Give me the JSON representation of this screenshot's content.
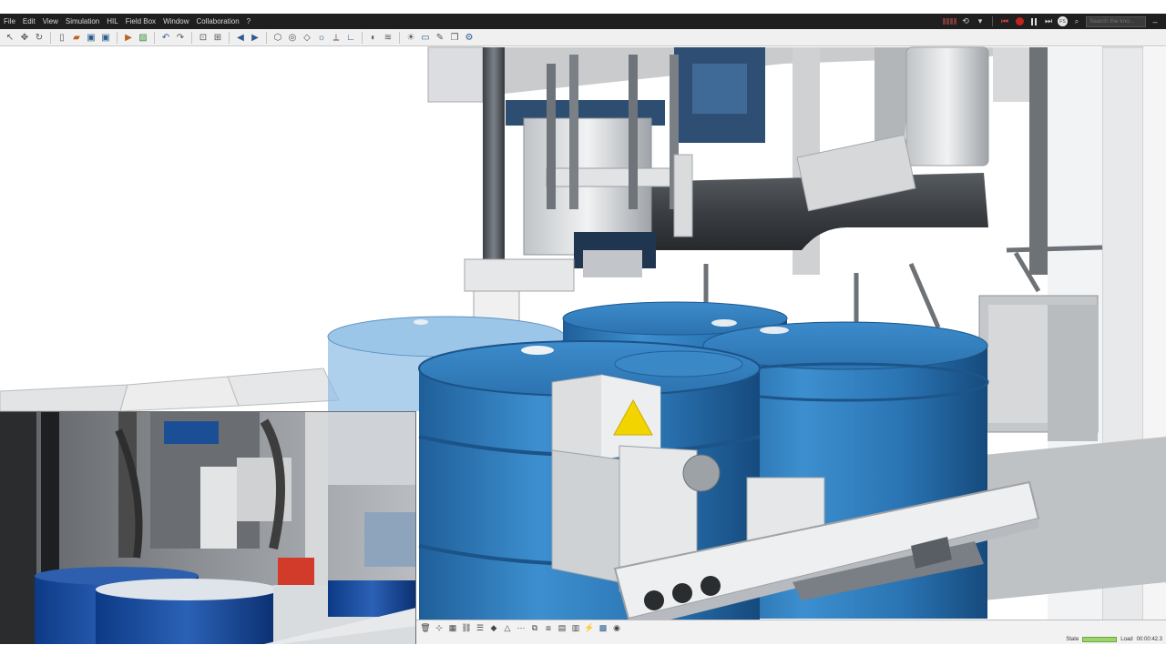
{
  "menu": {
    "items": [
      "File",
      "Edit",
      "View",
      "Simulation",
      "HIL",
      "Field Box",
      "Window",
      "Collaboration",
      "?"
    ]
  },
  "search": {
    "placeholder": "Search the kno..."
  },
  "user": {
    "initials": "FS"
  },
  "status": {
    "state_label": "State",
    "load_label": "Load",
    "time": "00:00:42.3"
  },
  "icons": {
    "toolbar": [
      "select-arrow-icon",
      "move-icon",
      "rotate-icon",
      "new-file-icon",
      "open-folder-icon",
      "save-icon",
      "save-as-icon",
      "simulation-icon",
      "picture-icon",
      "undo-icon",
      "redo-icon",
      "zoom-fit-icon",
      "zoom-region-icon",
      "back-icon",
      "forward-icon",
      "cube-view-icon",
      "camera-icon",
      "projection-icon",
      "light-icon",
      "measure-icon",
      "axis-icon",
      "render-mode-icon",
      "shading-icon",
      "visibility-icon",
      "grid-icon",
      "collision-icon",
      "layers-icon",
      "options-icon"
    ],
    "controls": [
      "record-indicator-icon",
      "rewind-icon",
      "stop-icon",
      "record-icon",
      "pause-icon",
      "step-forward-icon"
    ]
  },
  "colors": {
    "menu_bg": "#1f1f1f",
    "toolbar_bg": "#f0f0f0",
    "drum_blue": "#2f7fc1",
    "record_red": "#c0241c",
    "load_green": "#9bd46a"
  }
}
